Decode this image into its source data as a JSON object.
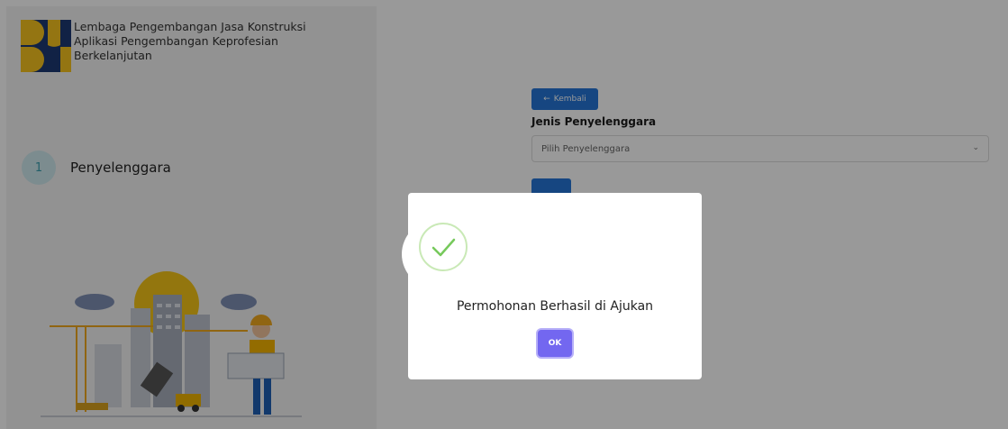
{
  "header": {
    "org_name": "Lembaga Pengembangan Jasa Konstruksi",
    "app_name": "Aplikasi Pengembangan Keprofesian Berkelanjutan"
  },
  "steps": [
    {
      "number": "1",
      "label": "Penyelenggara"
    }
  ],
  "form": {
    "back_label": "Kembali",
    "field_label": "Jenis Penyelenggara",
    "select_value": "Pilih Penyelenggara"
  },
  "modal": {
    "message": "Permohonan Berhasil di Ajukan",
    "ok_label": "OK"
  },
  "colors": {
    "primary_blue": "#2576d8",
    "ok_purple": "#7367f0",
    "success_green": "#76c95b",
    "logo_yellow": "#f7c31e",
    "logo_navy": "#1d3a74"
  },
  "icons": {
    "logo": "pupr-logo",
    "back": "arrow-left-icon",
    "select": "chevron-down-icon",
    "success": "check-icon"
  }
}
